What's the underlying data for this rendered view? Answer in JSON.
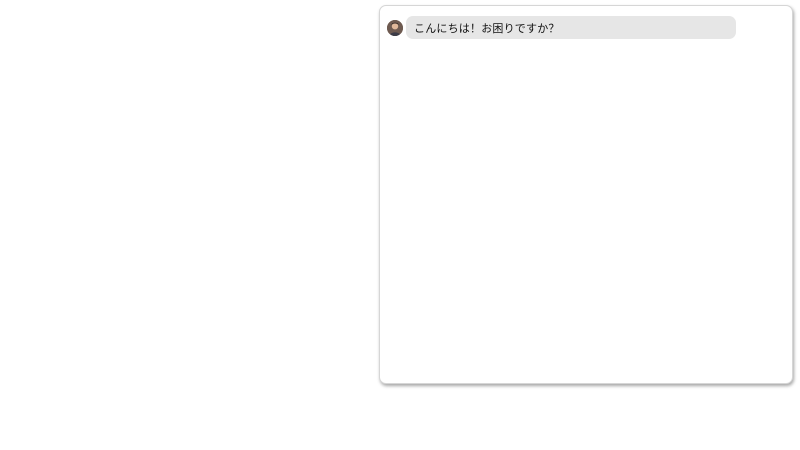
{
  "chat": {
    "messages": [
      {
        "sender_avatar": "person-avatar",
        "text": "こんにちは！お困りですか？"
      }
    ]
  },
  "colors": {
    "bubble_background": "#e6e6e6",
    "panel_border": "#d6d6d6",
    "page_background": "#ffffff"
  }
}
